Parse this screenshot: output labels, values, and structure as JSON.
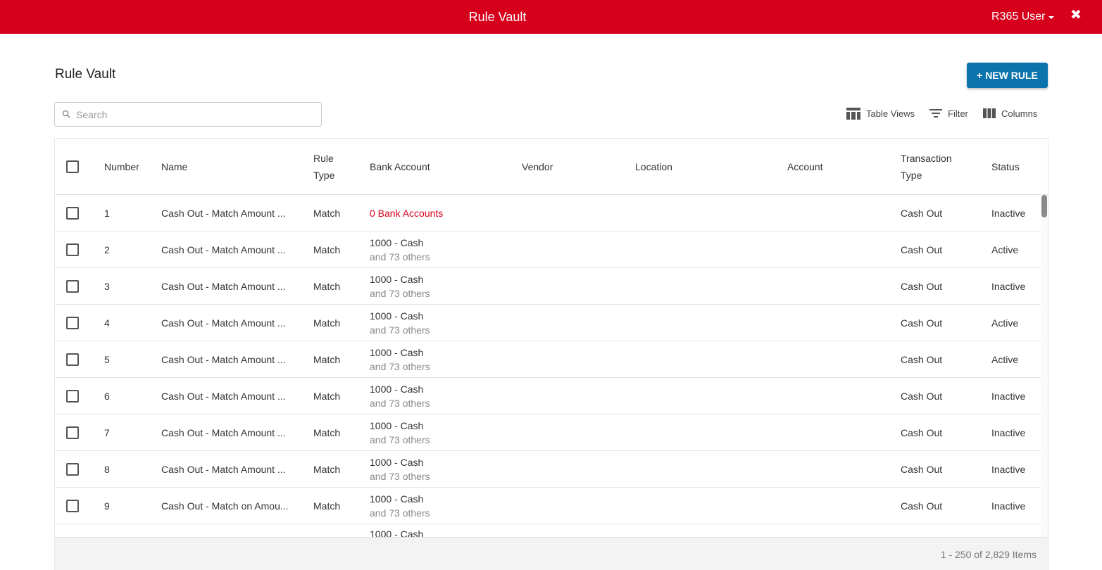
{
  "header": {
    "title": "Rule Vault",
    "user_label": "R365 User",
    "close_symbol": "✖",
    "bg_color": "#d6001c"
  },
  "page": {
    "title": "Rule Vault",
    "new_rule_label": "+ NEW RULE",
    "accent_color": "#0b74ad"
  },
  "search": {
    "placeholder": "Search",
    "value": ""
  },
  "toolbar": {
    "table_views_label": "Table Views",
    "filter_label": "Filter",
    "columns_label": "Columns"
  },
  "columns": {
    "number": "Number",
    "name": "Name",
    "rule_type_line1": "Rule",
    "rule_type_line2": "Type",
    "bank_account": "Bank Account",
    "vendor": "Vendor",
    "location": "Location",
    "account": "Account",
    "transaction_type_line1": "Transaction",
    "transaction_type_line2": "Type",
    "status": "Status"
  },
  "rows": [
    {
      "number": "1",
      "name": "Cash Out - Match Amount ...",
      "rule_type": "Match",
      "bank_main": "0 Bank Accounts",
      "bank_sub": "",
      "vendor": "",
      "location": "",
      "account": "",
      "transaction_type": "Cash Out",
      "status": "Inactive"
    },
    {
      "number": "2",
      "name": "Cash Out - Match Amount ...",
      "rule_type": "Match",
      "bank_main": "1000 - Cash",
      "bank_sub": "and 73 others",
      "vendor": "",
      "location": "",
      "account": "",
      "transaction_type": "Cash Out",
      "status": "Active"
    },
    {
      "number": "3",
      "name": "Cash Out - Match Amount ...",
      "rule_type": "Match",
      "bank_main": "1000 - Cash",
      "bank_sub": "and 73 others",
      "vendor": "",
      "location": "",
      "account": "",
      "transaction_type": "Cash Out",
      "status": "Inactive"
    },
    {
      "number": "4",
      "name": "Cash Out - Match Amount ...",
      "rule_type": "Match",
      "bank_main": "1000 - Cash",
      "bank_sub": "and 73 others",
      "vendor": "",
      "location": "",
      "account": "",
      "transaction_type": "Cash Out",
      "status": "Active"
    },
    {
      "number": "5",
      "name": "Cash Out - Match Amount ...",
      "rule_type": "Match",
      "bank_main": "1000 - Cash",
      "bank_sub": "and 73 others",
      "vendor": "",
      "location": "",
      "account": "",
      "transaction_type": "Cash Out",
      "status": "Active"
    },
    {
      "number": "6",
      "name": "Cash Out - Match Amount ...",
      "rule_type": "Match",
      "bank_main": "1000 - Cash",
      "bank_sub": "and 73 others",
      "vendor": "",
      "location": "",
      "account": "",
      "transaction_type": "Cash Out",
      "status": "Inactive"
    },
    {
      "number": "7",
      "name": "Cash Out - Match Amount ...",
      "rule_type": "Match",
      "bank_main": "1000 - Cash",
      "bank_sub": "and 73 others",
      "vendor": "",
      "location": "",
      "account": "",
      "transaction_type": "Cash Out",
      "status": "Inactive"
    },
    {
      "number": "8",
      "name": "Cash Out - Match Amount ...",
      "rule_type": "Match",
      "bank_main": "1000 - Cash",
      "bank_sub": "and 73 others",
      "vendor": "",
      "location": "",
      "account": "",
      "transaction_type": "Cash Out",
      "status": "Inactive"
    },
    {
      "number": "9",
      "name": "Cash Out - Match on Amou...",
      "rule_type": "Match",
      "bank_main": "1000 - Cash",
      "bank_sub": "and 73 others",
      "vendor": "",
      "location": "",
      "account": "",
      "transaction_type": "Cash Out",
      "status": "Inactive"
    },
    {
      "number": "",
      "name": "",
      "rule_type": "",
      "bank_main": "1000 - Cash",
      "bank_sub": "",
      "vendor": "",
      "location": "",
      "account": "",
      "transaction_type": "",
      "status": ""
    }
  ],
  "footer": {
    "pager_info": "1 - 250 of 2,829 Items"
  }
}
